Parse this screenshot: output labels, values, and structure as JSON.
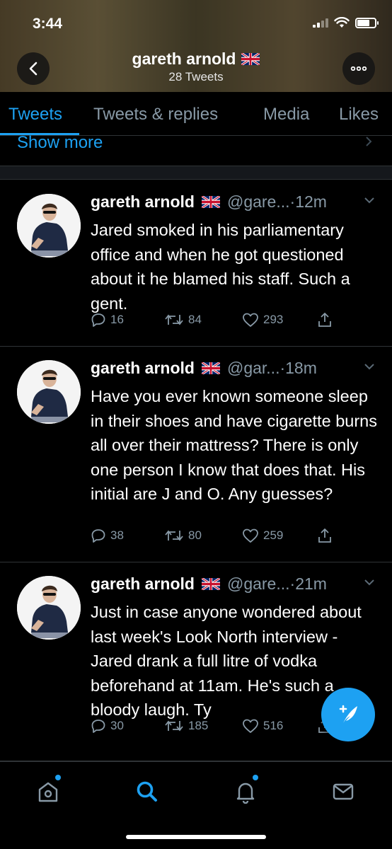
{
  "status_bar": {
    "time": "3:44"
  },
  "header": {
    "profile_name": "gareth arnold",
    "tweet_count": "28 Tweets"
  },
  "tabs": [
    {
      "label": "Tweets",
      "active": true
    },
    {
      "label": "Tweets & replies",
      "active": false
    },
    {
      "label": "Media",
      "active": false
    },
    {
      "label": "Likes",
      "active": false
    }
  ],
  "show_more": "Show more",
  "tweets": [
    {
      "name": "gareth arnold",
      "handle": "@gare...",
      "time": "·12m",
      "text": "Jared smoked in his parliamentary office and when he got questioned about it he blamed his staff. Such a gent.",
      "replies": "16",
      "retweets": "84",
      "likes": "293"
    },
    {
      "name": "gareth arnold",
      "handle": "@gar...",
      "time": "·18m",
      "text": "Have you ever known someone sleep in their shoes and have cigarette burns all over their mattress? There is only one person I know that does that. His initial are J and O. Any guesses?",
      "replies": "38",
      "retweets": "80",
      "likes": "259"
    },
    {
      "name": "gareth arnold",
      "handle": "@gare...",
      "time": "·21m",
      "text": "Just in case anyone wondered about last week's Look North interview - Jared drank a full litre of vodka beforehand at 11am. He's such a bloody laugh. Ty",
      "replies": "30",
      "retweets": "185",
      "likes": "516"
    }
  ],
  "colors": {
    "accent": "#1da1f2",
    "secondary_text": "#8899a6",
    "divider": "#2f3336",
    "background": "#000000"
  },
  "icons": [
    "back-icon",
    "more-icon",
    "uk-flag-icon",
    "reply-icon",
    "retweet-icon",
    "like-icon",
    "share-icon",
    "compose-icon",
    "home-icon",
    "search-icon",
    "notifications-icon",
    "messages-icon"
  ]
}
